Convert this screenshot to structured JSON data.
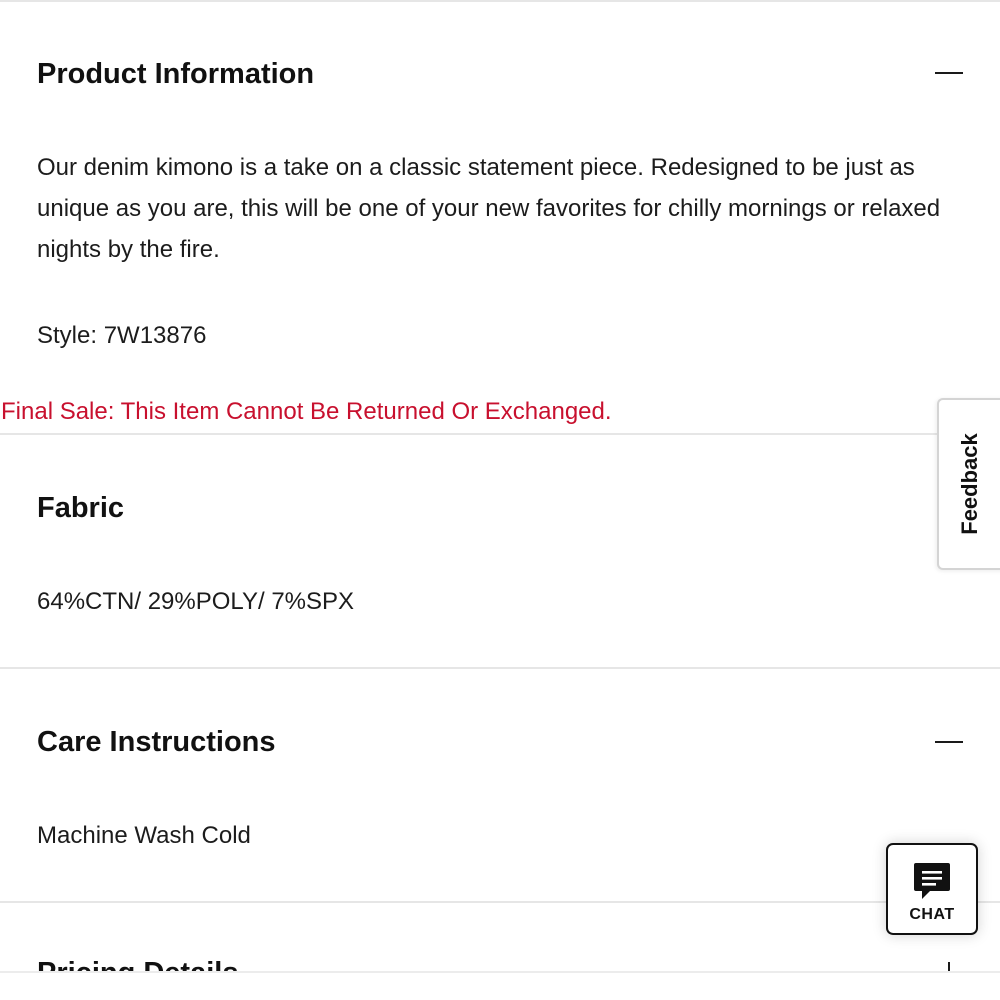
{
  "product_information": {
    "title": "Product Information",
    "toggle_icon": "minus-icon",
    "description": "Our denim kimono is a take on a classic statement piece. Redesigned to be just as unique as you are, this will be one of your new favorites for chilly mornings or relaxed nights by the fire.",
    "style": "Style: 7W13876",
    "final_sale": "Final Sale: This Item Cannot Be Returned Or Exchanged."
  },
  "fabric": {
    "title": "Fabric",
    "content": "64%CTN/ 29%POLY/ 7%SPX"
  },
  "care_instructions": {
    "title": "Care Instructions",
    "toggle_icon": "minus-icon",
    "content": "Machine Wash Cold"
  },
  "pricing_details": {
    "title": "Pricing Details",
    "toggle_icon": "plus-icon"
  },
  "feedback_tab": {
    "label": "Feedback"
  },
  "chat_button": {
    "label": "CHAT",
    "icon": "chat-bubble-icon"
  },
  "colors": {
    "final_sale_text": "#c8102e",
    "divider": "#e6e6e6",
    "text": "#1c1c1c"
  }
}
